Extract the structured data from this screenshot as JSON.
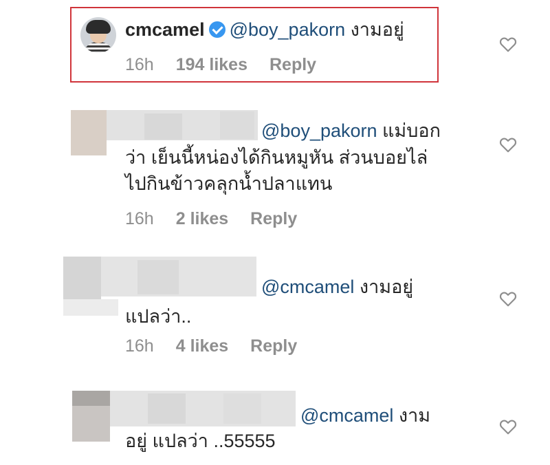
{
  "comments": [
    {
      "username": "cmcamel",
      "verified": true,
      "mention": "@boy_pakorn",
      "text_line1": " งามอยู่",
      "time": "16h",
      "likes": "194 likes",
      "reply": "Reply",
      "highlighted": true
    },
    {
      "mention": "@boy_pakorn",
      "text_line1": " แม่บอก",
      "text_line2": "ว่า เย็นนี้หน่องได้กินหมูหัน  ส่วนบอยไล่",
      "text_line3": "ไปกินข้าวคลุกน้ำปลาแทน",
      "time": "16h",
      "likes": "2 likes",
      "reply": "Reply"
    },
    {
      "mention": "@cmcamel",
      "text_line1": "  งามอยู่",
      "text_line2": "แปลว่า..",
      "time": "16h",
      "likes": "4 likes",
      "reply": "Reply"
    },
    {
      "mention": "@cmcamel",
      "text_line1": "  งาม",
      "text_line2": "อยู่ แปลว่า ..55555"
    }
  ],
  "icons": {
    "like": "heart-outline-icon",
    "verified": "verified-badge-icon"
  },
  "colors": {
    "highlight_border": "#d0343a",
    "mention": "#1f4e79",
    "verified": "#3897f0",
    "meta": "#8e8e8e"
  }
}
